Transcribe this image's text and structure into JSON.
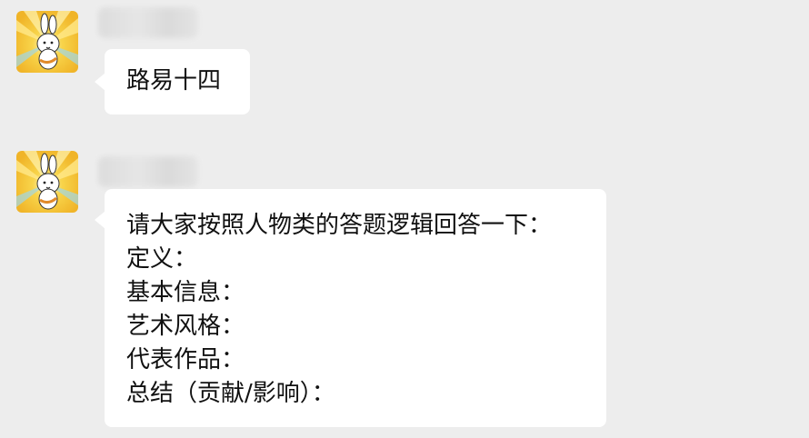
{
  "colors": {
    "background": "#ededed",
    "bubble": "#ffffff",
    "text": "#111111",
    "avatar_gold": "#f2c230"
  },
  "messages": [
    {
      "sender": "",
      "avatar_icon": "bunny-cartoon-avatar-icon",
      "text_lines": [
        "路易十四"
      ]
    },
    {
      "sender": "",
      "avatar_icon": "bunny-cartoon-avatar-icon",
      "text_lines": [
        "请大家按照人物类的答题逻辑回答一下：",
        "定义：",
        "基本信息：",
        "艺术风格：",
        "代表作品：",
        "总结（贡献/影响）："
      ]
    }
  ]
}
